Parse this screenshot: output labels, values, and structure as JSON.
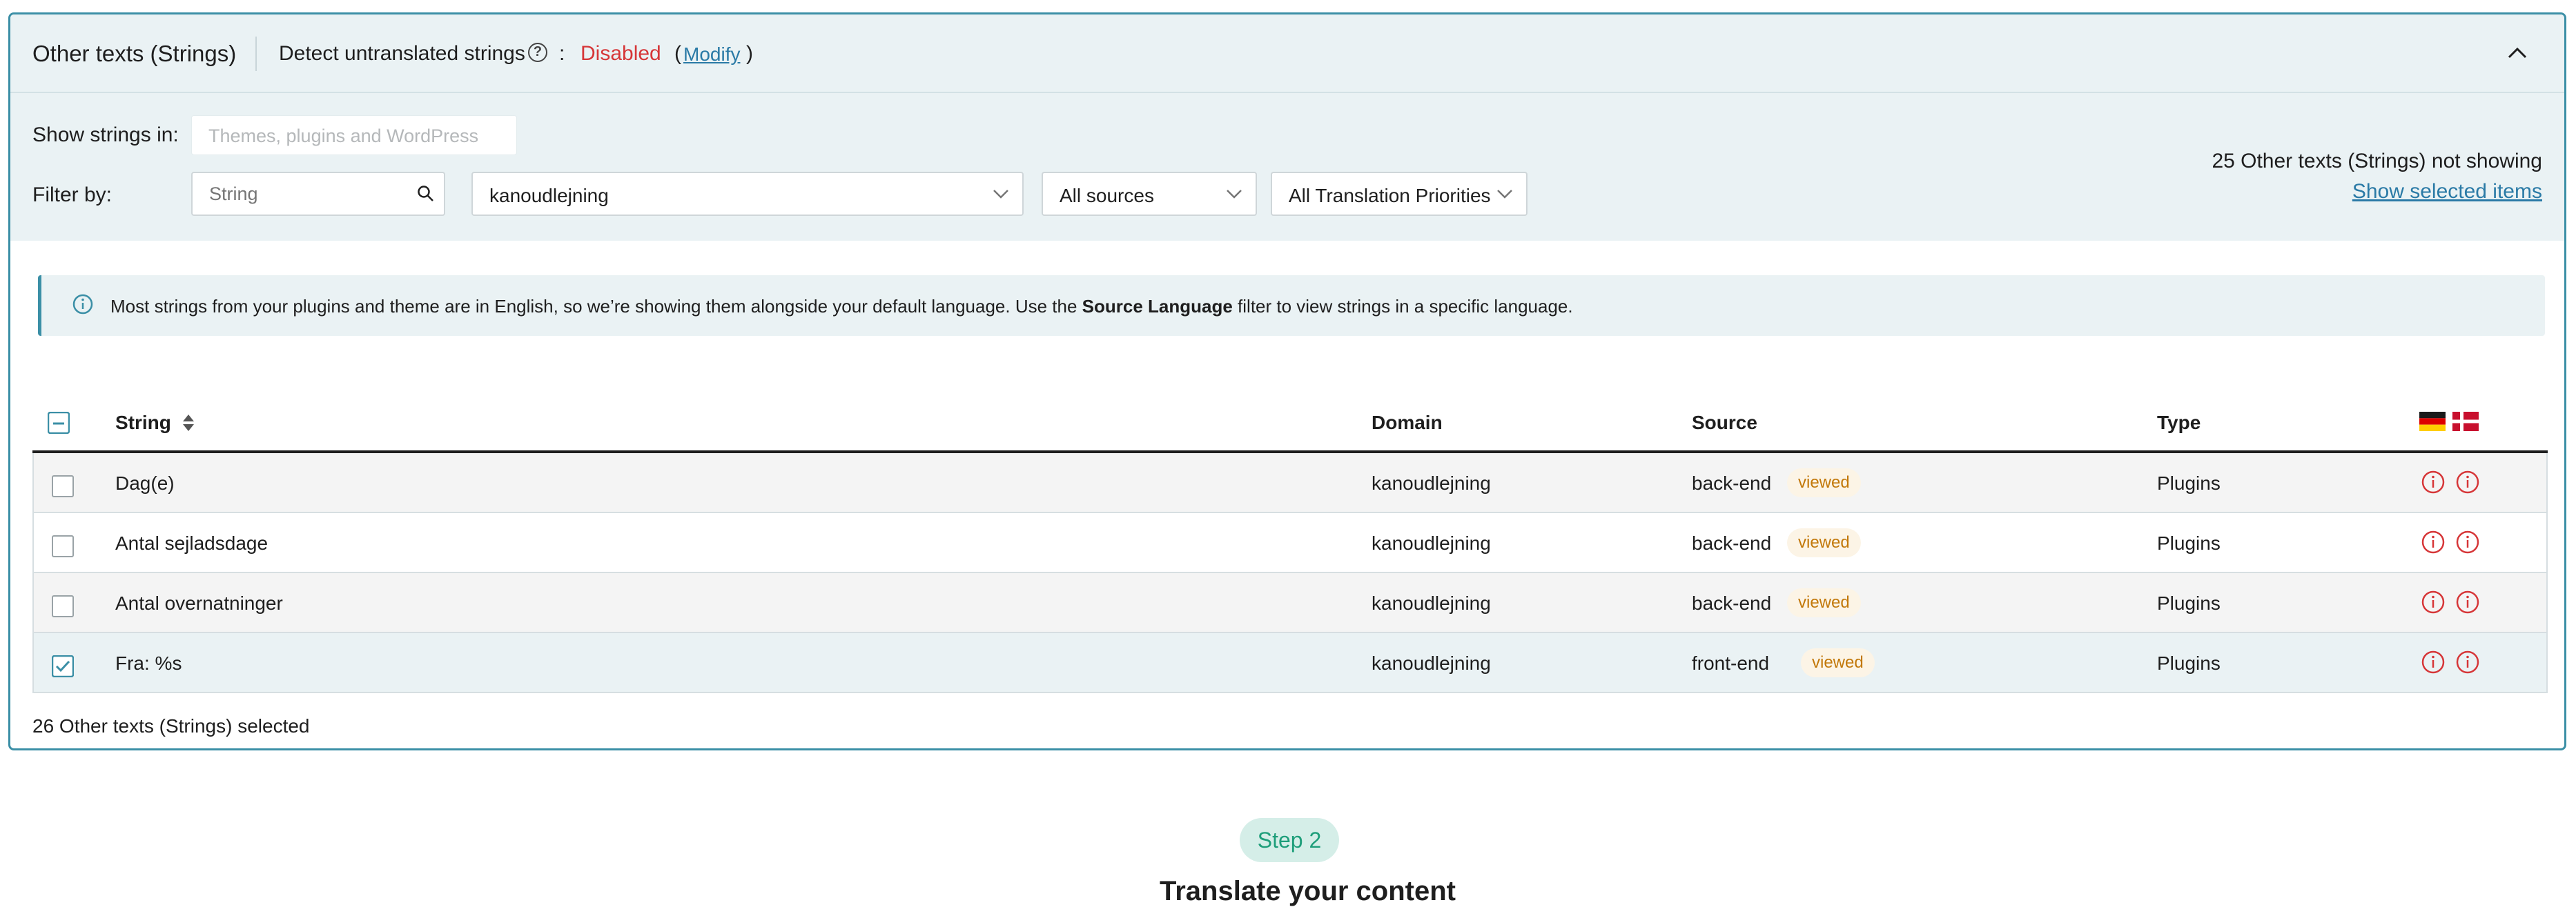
{
  "header": {
    "title": "Other texts (Strings)",
    "detect_label": "Detect untranslated strings",
    "colon": ":",
    "status": "Disabled",
    "paren_open": "(",
    "modify_label": "Modify",
    "paren_close": ")",
    "status_color": "#d63638"
  },
  "filters": {
    "show_label": "Show strings in:",
    "show_placeholder": "Themes, plugins and WordPress",
    "filter_label": "Filter by:",
    "string_placeholder": "String",
    "domain_value": "kanoudlejning",
    "sources_value": "All sources",
    "priority_value": "All Translation Priorities",
    "not_showing": "25 Other texts (Strings) not showing",
    "show_selected": "Show selected items"
  },
  "notice": {
    "pre": "Most strings from your plugins and theme are in English, so we’re showing them alongside your default language. Use the ",
    "bold": "Source Language",
    "post": " filter to view strings in a specific language."
  },
  "table": {
    "headers": {
      "string": "String",
      "domain": "Domain",
      "source": "Source",
      "type": "Type"
    },
    "flags": [
      "german-flag-icon",
      "danish-flag-icon"
    ],
    "rows": [
      {
        "string": "Dag(e)",
        "domain": "kanoudlejning",
        "source": "back-end",
        "badge": "viewed",
        "type": "Plugins",
        "checked": false
      },
      {
        "string": "Antal sejladsdage",
        "domain": "kanoudlejning",
        "source": "back-end",
        "badge": "viewed",
        "type": "Plugins",
        "checked": false
      },
      {
        "string": "Antal overnatninger",
        "domain": "kanoudlejning",
        "source": "back-end",
        "badge": "viewed",
        "type": "Plugins",
        "checked": false
      },
      {
        "string": "Fra: %s",
        "domain": "kanoudlejning",
        "source": "front-end",
        "badge": "viewed",
        "type": "Plugins",
        "checked": true
      }
    ]
  },
  "footer": {
    "selected_count": "26 Other texts (Strings) selected"
  },
  "step": {
    "pill": "Step 2",
    "title": "Translate your content"
  },
  "colors": {
    "accent": "#3b8fa6",
    "link": "#2a7aa6",
    "warning_icon": "#d63638",
    "badge_text": "#c2780a",
    "step_green": "#1e9e7a"
  }
}
